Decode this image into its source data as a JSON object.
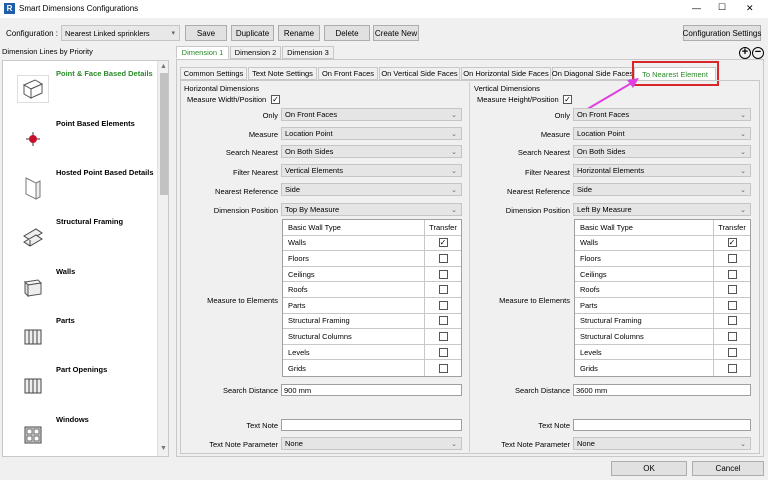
{
  "window": {
    "title": "Smart Dimensions Configurations",
    "min": "—",
    "max": "☐",
    "close": "✕"
  },
  "toolbar": {
    "config_label": "Configuration :",
    "config_value": "Nearest Linked sprinklers",
    "save": "Save",
    "duplicate": "Duplicate",
    "rename": "Rename",
    "delete": "Delete",
    "create_new": "Create New",
    "config_settings": "Configuration Settings"
  },
  "sidebar": {
    "header": "Dimension Lines by Priority",
    "items": [
      {
        "label": "Point & Face Based Details",
        "icon": "face-box-icon",
        "selected": true
      },
      {
        "label": "Point Based Elements",
        "icon": "point-element-icon"
      },
      {
        "label": "Hosted Point Based Details",
        "icon": "hosted-detail-icon"
      },
      {
        "label": "Structural Framing",
        "icon": "structural-framing-icon"
      },
      {
        "label": "Walls",
        "icon": "wall-icon"
      },
      {
        "label": "Parts",
        "icon": "parts-icon"
      },
      {
        "label": "Part Openings",
        "icon": "part-openings-icon"
      },
      {
        "label": "Windows",
        "icon": "window-icon"
      }
    ]
  },
  "dim_tabs": [
    "Dimension 1",
    "Dimension 2",
    "Dimension 3"
  ],
  "sub_tabs": [
    "Common Settings",
    "Text Note Settings",
    "On Front Faces",
    "On Vertical Side Faces",
    "On Horizontal Side Faces",
    "On Diagonal Side Faces",
    "To Nearest Element"
  ],
  "highlight_color": "#d9262b",
  "arrow_color": "#e040e0",
  "accent_green": "#2a8a2a",
  "horizontal": {
    "section": "Horizontal Dimensions",
    "measure_label": "Measure Width/Position",
    "only_label": "Only",
    "only_value": "On Front Faces",
    "measure_lbl": "Measure",
    "measure_value": "Location Point",
    "search_nearest_lbl": "Search Nearest",
    "search_nearest_value": "On Both Sides",
    "filter_nearest_lbl": "Filter Nearest",
    "filter_nearest_value": "Vertical Elements",
    "nearest_ref_lbl": "Nearest Reference",
    "nearest_ref_value": "Side",
    "dim_pos_lbl": "Dimension Position",
    "dim_pos_value": "Top By Measure",
    "measure_to_lbl": "Measure to Elements",
    "table_header": [
      "Basic Wall Type",
      "Transfer"
    ],
    "rows": [
      {
        "name": "Walls",
        "checked": "✓"
      },
      {
        "name": "Floors",
        "checked": ""
      },
      {
        "name": "Ceilings",
        "checked": ""
      },
      {
        "name": "Roofs",
        "checked": ""
      },
      {
        "name": "Parts",
        "checked": ""
      },
      {
        "name": "Structural Framing",
        "checked": ""
      },
      {
        "name": "Structural Columns",
        "checked": ""
      },
      {
        "name": "Levels",
        "checked": ""
      },
      {
        "name": "Grids",
        "checked": ""
      }
    ],
    "search_distance_lbl": "Search Distance",
    "search_distance_value": "900 mm",
    "text_note_lbl": "Text Note",
    "text_note_value": "",
    "text_note_param_lbl": "Text Note Parameter",
    "text_note_param_value": "None"
  },
  "vertical": {
    "section": "Vertical Dimensions",
    "measure_label": "Measure Height/Position",
    "only_label": "Only",
    "only_value": "On Front Faces",
    "measure_lbl": "Measure",
    "measure_value": "Location Point",
    "search_nearest_lbl": "Search Nearest",
    "search_nearest_value": "On Both Sides",
    "filter_nearest_lbl": "Filter Nearest",
    "filter_nearest_value": "Horizontal Elements",
    "nearest_ref_lbl": "Nearest Reference",
    "nearest_ref_value": "Side",
    "dim_pos_lbl": "Dimension Position",
    "dim_pos_value": "Left By Measure",
    "measure_to_lbl": "Measure to Elements",
    "table_header": [
      "Basic Wall Type",
      "Transfer"
    ],
    "rows": [
      {
        "name": "Walls",
        "checked": "✓"
      },
      {
        "name": "Floors",
        "checked": ""
      },
      {
        "name": "Ceilings",
        "checked": ""
      },
      {
        "name": "Roofs",
        "checked": ""
      },
      {
        "name": "Parts",
        "checked": ""
      },
      {
        "name": "Structural Framing",
        "checked": ""
      },
      {
        "name": "Structural Columns",
        "checked": ""
      },
      {
        "name": "Levels",
        "checked": ""
      },
      {
        "name": "Grids",
        "checked": ""
      }
    ],
    "search_distance_lbl": "Search Distance",
    "search_distance_value": "3600 mm",
    "text_note_lbl": "Text Note",
    "text_note_value": "",
    "text_note_param_lbl": "Text Note Parameter",
    "text_note_param_value": "None"
  },
  "footer": {
    "ok": "OK",
    "cancel": "Cancel"
  }
}
